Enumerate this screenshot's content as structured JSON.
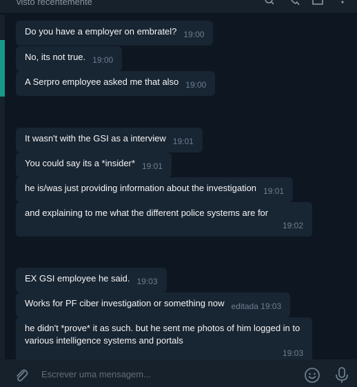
{
  "header": {
    "status": "visto recentemente"
  },
  "messages": [
    {
      "text": "Do you have a employer on embratel?",
      "time": "19:00"
    },
    {
      "text": "No, its not true.",
      "time": "19:00"
    },
    {
      "text": "A Serpro employee asked me that also",
      "time": "19:00"
    },
    {
      "text": "It wasn't with the GSI as a interview",
      "time": "19:01"
    },
    {
      "text": "You could say its a *insider*",
      "time": "19:01"
    },
    {
      "text": "he is/was just providing information about the investigation",
      "time": "19:01"
    },
    {
      "text": "and explaining to me what the different police systems are for",
      "time": "19:02"
    },
    {
      "text": "EX GSI employee he said.",
      "time": "19:03"
    },
    {
      "text": "Works for PF ciber investigation or something now",
      "time": "editada 19:03"
    },
    {
      "text": "he didn't *prove* it as such. but he sent me photos of him logged in to various intelligence systems and portals",
      "time": "19:03"
    }
  ],
  "composer": {
    "placeholder": "Escrever uma mensagem..."
  },
  "icons": {
    "attach": "paperclip-icon",
    "emoji": "emoji-icon",
    "mic": "microphone-icon"
  },
  "colors": {
    "background": "#0e1621",
    "bubble": "#182533",
    "panel": "#17212b",
    "accent": "#169b8a",
    "time": "#6d7f8f"
  }
}
